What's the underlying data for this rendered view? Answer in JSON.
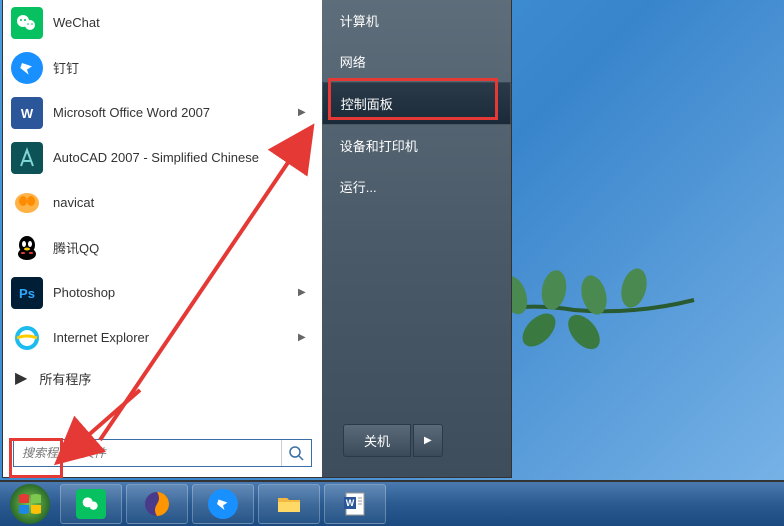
{
  "start_menu": {
    "programs": [
      {
        "label": "WeChat",
        "icon": "wechat",
        "has_submenu": false
      },
      {
        "label": "钉钉",
        "icon": "dingtalk",
        "has_submenu": false
      },
      {
        "label": "Microsoft Office Word 2007",
        "icon": "word",
        "has_submenu": true
      },
      {
        "label": "AutoCAD 2007 - Simplified Chinese",
        "icon": "autocad",
        "has_submenu": false
      },
      {
        "label": "navicat",
        "icon": "navicat",
        "has_submenu": false
      },
      {
        "label": "腾讯QQ",
        "icon": "qq",
        "has_submenu": false
      },
      {
        "label": "Photoshop",
        "icon": "ps",
        "has_submenu": true
      },
      {
        "label": "Internet Explorer",
        "icon": "ie",
        "has_submenu": true
      }
    ],
    "all_programs_label": "所有程序",
    "search_placeholder": "搜索程序和文件",
    "right_items": [
      {
        "label": "计算机",
        "highlighted": false
      },
      {
        "label": "网络",
        "highlighted": false
      },
      {
        "label": "控制面板",
        "highlighted": true
      },
      {
        "label": "设备和打印机",
        "highlighted": false
      },
      {
        "label": "运行...",
        "highlighted": false
      }
    ],
    "shutdown_label": "关机"
  },
  "taskbar": {
    "items": [
      "wechat",
      "firefox",
      "dingtalk",
      "explorer",
      "word"
    ]
  }
}
